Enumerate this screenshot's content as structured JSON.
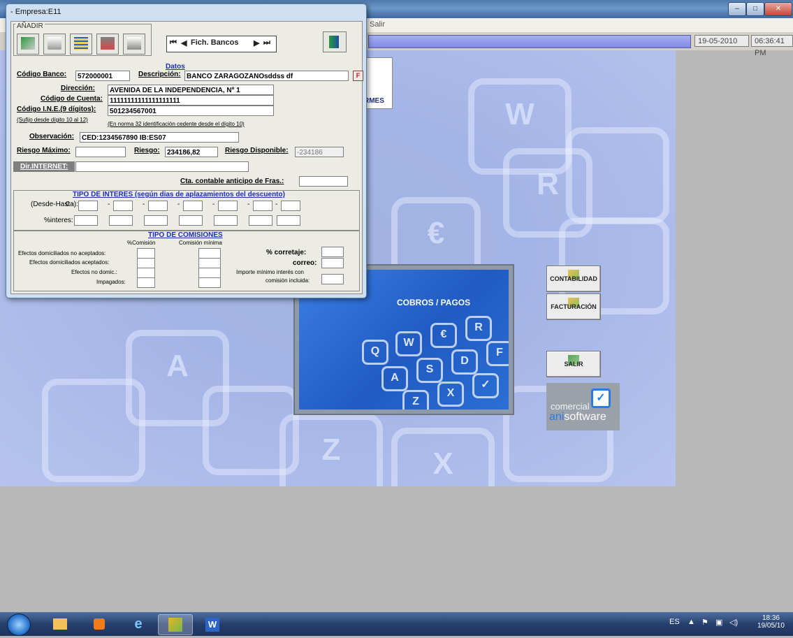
{
  "app": {
    "menu_items": [
      "Salir"
    ],
    "date": "19-05-2010",
    "time": "06:36:41 PM",
    "informes_label": "RMES",
    "cobros_label": "COBROS / PAGOS",
    "modules": {
      "contabilidad": "CONTABILIDAD",
      "facturacion": "FACTURACIÓN",
      "salir": "SALIR"
    },
    "logo_top": "comercial",
    "logo_bottom_a": "ani",
    "logo_bottom_b": "software"
  },
  "dialog": {
    "title": "- Empresa:E11",
    "toolbar_group_label": "AÑADIR",
    "nav_label": "Fich. Bancos",
    "section_datos": "Datos",
    "codigo_banco_label": "Código Banco:",
    "codigo_banco_value": "572000001",
    "descripcion_label": "Descripción:",
    "descripcion_value": "BANCO ZARAGOZANOsddss df",
    "direccion_label": "Dirección:",
    "direccion_value": "AVENIDA DE LA INDEPENDENCIA, Nº 1",
    "codigo_cuenta_label": "Código de Cuenta:",
    "codigo_cuenta_value": "11111111111111111111",
    "ine_label": "Código I.N.E.(9 dígitos):",
    "ine_value": "501234567001",
    "sufijo_note": "(Sufijo desde dígito 10 al 12)",
    "norma_note": "(En norma 32 identificación cedente desde el dígito 10)",
    "observacion_label": "Observación:",
    "observacion_value": "CED:1234567890          IB:ES07",
    "riesgo_max_label": "Riesgo Máximo:",
    "riesgo_max_value": "",
    "riesgo_label": "Riesgo:",
    "riesgo_value": "234186,82",
    "riesgo_disp_label": "Riesgo Disponible:",
    "riesgo_disp_value": "-234186",
    "dir_internet_label": "Dir.INTERNET:",
    "dir_internet_value": "",
    "cta_anticipo_label": "Cta. contable anticipo de Fras.:",
    "cta_anticipo_value": "",
    "interes_title": "TIPO DE INTERES (según dias de aplazamientos del descuento)",
    "desde_hasta_label": "(Desde-Hasta):",
    "desde_start": "0 -",
    "interes_label": "%interes:",
    "comisiones_title": "TIPO DE COMISIONES",
    "col_comision": "%Comisión",
    "col_minima": "Comisión mínima",
    "efectos_no_aceptados": "Efectos domiciliados no aceptados:",
    "efectos_aceptados": "Efectos domiciliados aceptados:",
    "efectos_no_domic": "Efectos no domic.:",
    "impagados": "Impagados:",
    "corretaje_label": "% corretaje:",
    "correo_label": "correo:",
    "importe_minimo_1": "Importe mínimo interés con",
    "importe_minimo_2": "comisión incluida:",
    "f_button": "F"
  },
  "taskbar": {
    "lang": "ES",
    "clock_time": "18:36",
    "clock_date": "19/05/10"
  }
}
